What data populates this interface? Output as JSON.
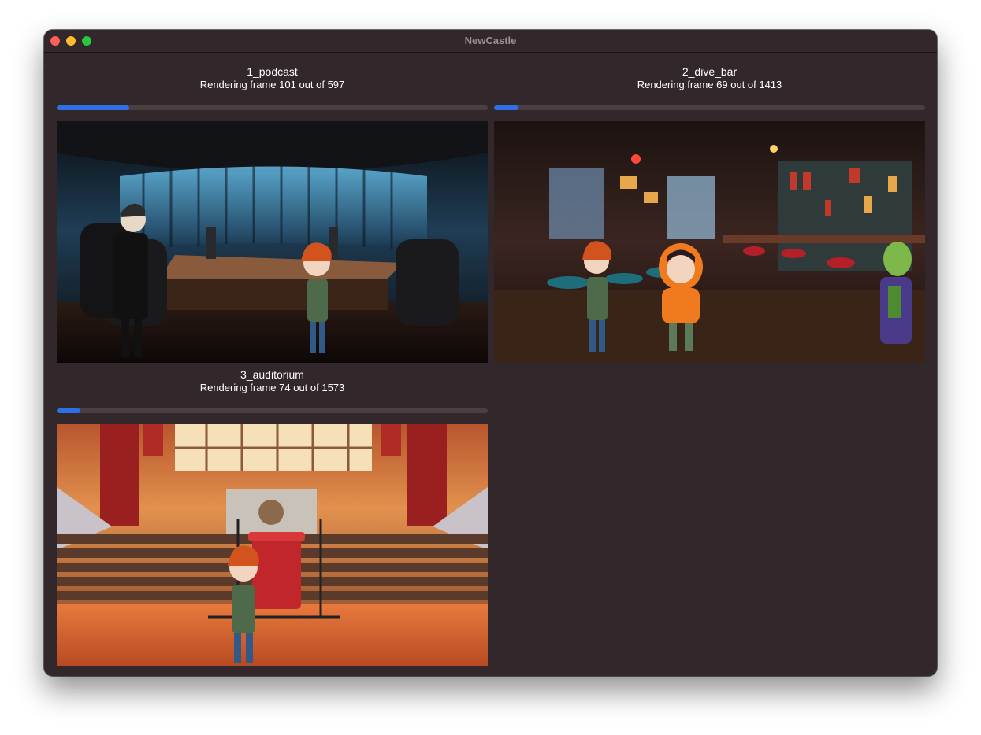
{
  "window": {
    "title": "NewCastle"
  },
  "jobs": [
    {
      "name": "1_podcast",
      "status": "Rendering frame 101 out of 597",
      "frame": 101,
      "total": 597,
      "progress": 0.169,
      "preview": "podcast studio scene"
    },
    {
      "name": "2_dive_bar",
      "status": "Rendering frame 69 out of 1413",
      "frame": 69,
      "total": 1413,
      "progress": 0.057,
      "preview": "dive bar scene"
    },
    {
      "name": "3_auditorium",
      "status": "Rendering frame 74 out of 1573",
      "frame": 74,
      "total": 1573,
      "progress": 0.054,
      "preview": "auditorium stage scene"
    }
  ],
  "colors": {
    "accent": "#2f6fe6",
    "background": "#32272a",
    "track": "#4a3f42"
  }
}
